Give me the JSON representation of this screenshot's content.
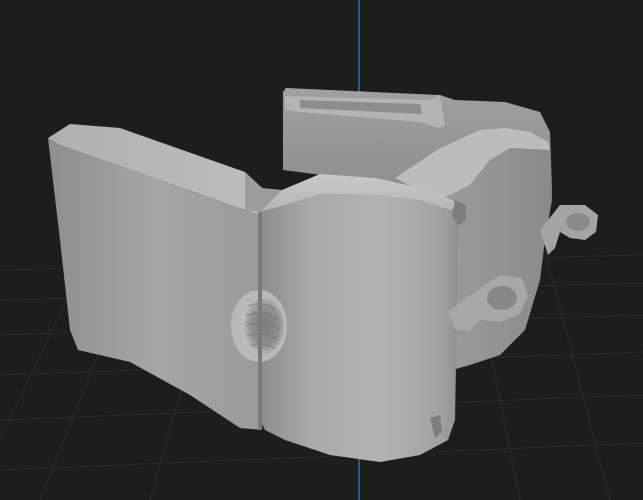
{
  "viewport": {
    "background": "#1d1d1d",
    "grid_color": "#2b2b2b",
    "axis_z_color": "#3d7fc4",
    "model_base_color": "#9a9a9a",
    "model_highlight_color": "#c4c4c4",
    "model_shadow_color": "#6a6a6a"
  },
  "model": {
    "icon": "mesh-object-icon"
  }
}
